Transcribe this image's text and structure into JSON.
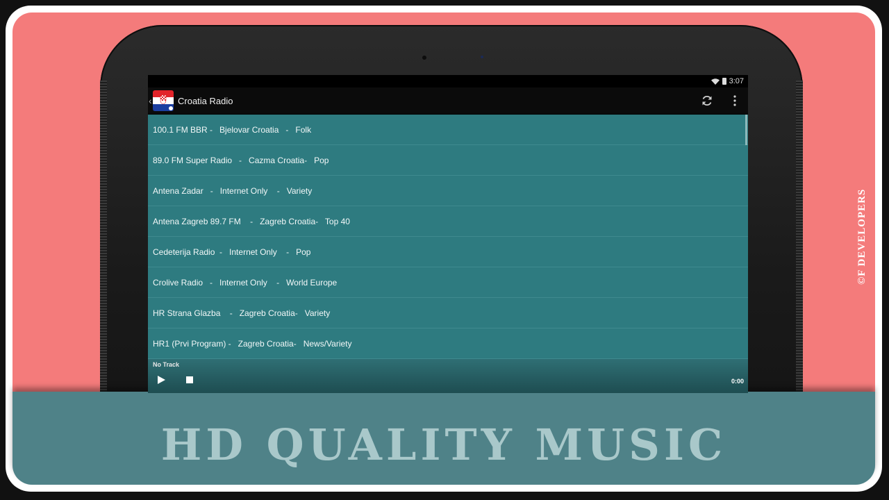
{
  "status_bar": {
    "time": "3:07"
  },
  "action_bar": {
    "back_glyph": "‹",
    "title": "Croatia Radio"
  },
  "stations": [
    "100.1 FM BBR -   Bjelovar Croatia   -   Folk",
    "89.0 FM Super Radio   -   Cazma Croatia-   Pop",
    "Antena Zadar   -   Internet Only    -   Variety",
    "Antena Zagreb 89.7 FM    -   Zagreb Croatia-   Top 40",
    "Cedeterija Radio  -   Internet Only    -   Pop",
    "Crolive Radio   -   Internet Only    -   World Europe",
    "HR Strana Glazba    -   Zagreb Croatia-   Variety",
    "HR1 (Prvi Program) -   Zagreb Croatia-   News/Variety"
  ],
  "player": {
    "track": "No Track",
    "time": "0:00"
  },
  "banner": {
    "text": "HD QUALITY MUSIC"
  },
  "watermark": "©F DEVELOPERS",
  "colors": {
    "background": "#f47b7b",
    "list": "#2e7b80",
    "banner": "#4f8288",
    "banner_text": "#a9c8ca"
  }
}
